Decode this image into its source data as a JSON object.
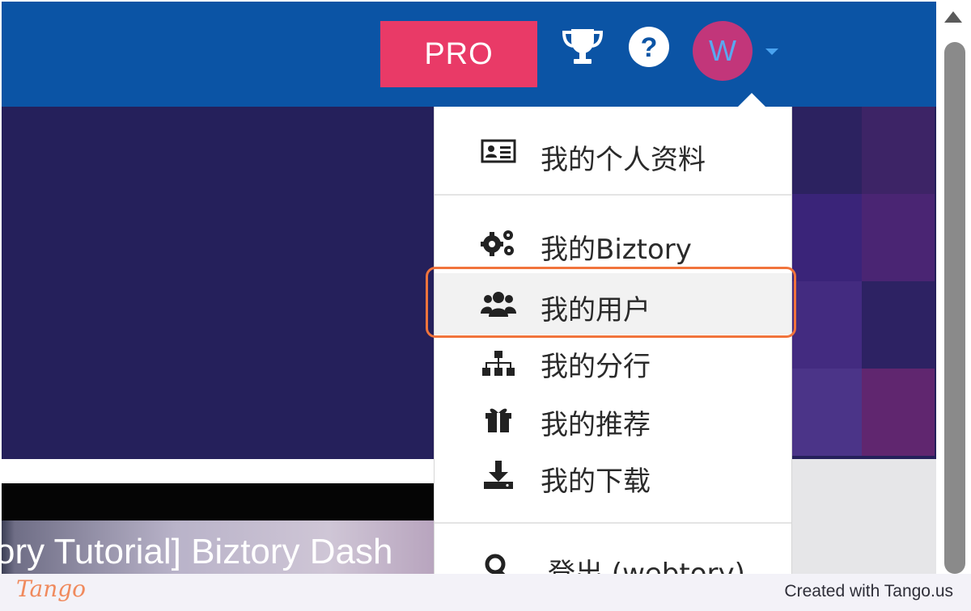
{
  "header": {
    "pro_label": "PRO",
    "avatar_initial": "W",
    "colors": {
      "header_bg": "#0b54a5",
      "pro_bg": "#e93a67",
      "avatar_bg": "#c2367a"
    }
  },
  "dropdown": {
    "items": [
      {
        "label": "我的个人资料",
        "icon": "id-card-icon"
      },
      {
        "label": "我的Biztory",
        "icon": "gears-icon"
      },
      {
        "label": "我的用户",
        "icon": "users-icon",
        "highlighted": true
      },
      {
        "label": "我的分行",
        "icon": "sitemap-icon"
      },
      {
        "label": "我的推荐",
        "icon": "gift-icon"
      },
      {
        "label": "我的下载",
        "icon": "download-icon"
      },
      {
        "label": "登出 (webtory)",
        "icon": "logout-icon"
      }
    ],
    "highlight_color": "#f1743c"
  },
  "background": {
    "video_title": "ory Tutorial] Biztory Dash"
  },
  "footer": {
    "brand": "Tango",
    "created_with": "Created with Tango.us"
  }
}
